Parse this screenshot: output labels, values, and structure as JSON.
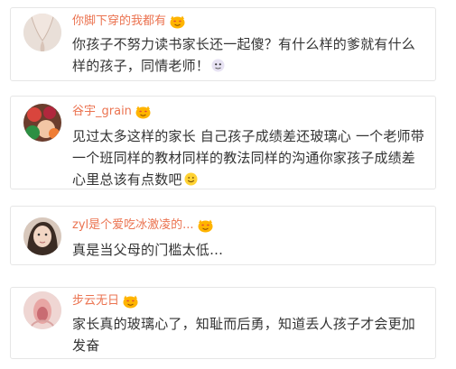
{
  "comments": [
    {
      "username": "你脚下穿的我都有",
      "text": "你孩子不努力读书家长还一起傻？有什么样的爹就有什么样的孩子，同情老师！",
      "emoji": "doge-emoji"
    },
    {
      "username": "谷宇_grain",
      "text": "见过太多这样的家长 自己孩子成绩差还玻璃心 一个老师带一个班同样的教材同样的教法同样的沟通你家孩子成绩差心里总该有点数吧",
      "emoji": "smile-emoji"
    },
    {
      "username": "zyl是个爱吃冰激凌的...",
      "text": "真是当父母的门槛太低…"
    },
    {
      "username": "步云无日",
      "text": "家长真的玻璃心了，知耻而后勇，知道丢人孩子才会更加发奋"
    }
  ],
  "colors": {
    "username": "#eb7350",
    "text": "#333333",
    "border": "#e6e6e6"
  }
}
